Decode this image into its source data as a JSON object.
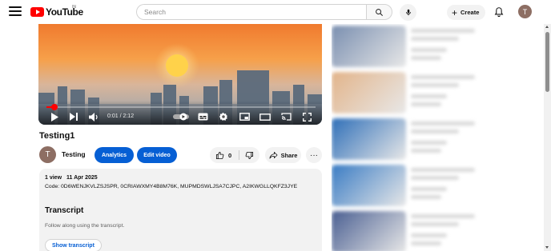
{
  "header": {
    "logo_text": "YouTube",
    "country_code": "IN",
    "search_placeholder": "Search",
    "create_label": "Create",
    "account_initial": "T"
  },
  "player": {
    "time_display": "0:01 / 2:12",
    "progress_fraction": 0.03
  },
  "video": {
    "title": "Testing1",
    "channel_initial": "T",
    "channel_name": "Testing",
    "analytics_label": "Analytics",
    "edit_label": "Edit video",
    "like_count": "0",
    "share_label": "Share",
    "more_label": "···"
  },
  "description": {
    "views": "1 view",
    "date": "11 Apr 2025",
    "code": "Code: 0D6WENJKVLZSJSPR, 0CRIAWXMY4B8M76K, MUPMDSWLJSA7CJPC, A2IKWGLLQKFZ3JYE",
    "transcript_heading": "Transcript",
    "transcript_sub": "Follow along using the transcript.",
    "transcript_button": "Show transcript"
  },
  "recommendations": [
    {
      "thumb_color": "#7a8fb0"
    },
    {
      "thumb_color": "#e2b48a"
    },
    {
      "thumb_color": "#2f6fb8"
    },
    {
      "thumb_color": "#3a7cc4"
    },
    {
      "thumb_color": "#4a5f92"
    }
  ],
  "colors": {
    "brand_red": "#ff0000",
    "button_blue": "#065fd4",
    "surface_gray": "#f2f2f2"
  }
}
